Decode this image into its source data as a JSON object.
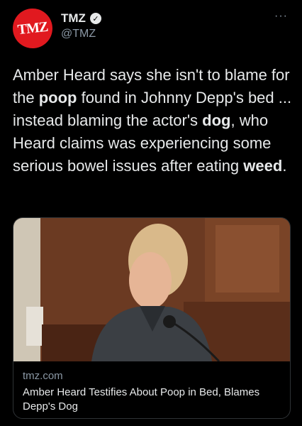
{
  "header": {
    "avatar_text": "TMZ",
    "display_name": "TMZ",
    "handle": "@TMZ",
    "more_icon": "ellipsis-icon",
    "verified_icon": "verified-badge-icon"
  },
  "tweet": {
    "parts": [
      {
        "text": "Amber Heard says she isn't to blame for the ",
        "bold": false
      },
      {
        "text": "poop",
        "bold": true
      },
      {
        "text": " found in Johnny Depp's bed ... instead blaming the actor's ",
        "bold": false
      },
      {
        "text": "dog",
        "bold": true
      },
      {
        "text": ", who Heard claims was experiencing some serious bowel issues after eating ",
        "bold": false
      },
      {
        "text": "weed",
        "bold": true
      },
      {
        "text": ".",
        "bold": false
      }
    ]
  },
  "card": {
    "domain": "tmz.com",
    "title": "Amber Heard Testifies About Poop in Bed, Blames Depp's Dog"
  },
  "colors": {
    "brand": "#e1191f",
    "background": "#000000",
    "text": "#e7e9ea",
    "muted": "#8b98a5"
  }
}
